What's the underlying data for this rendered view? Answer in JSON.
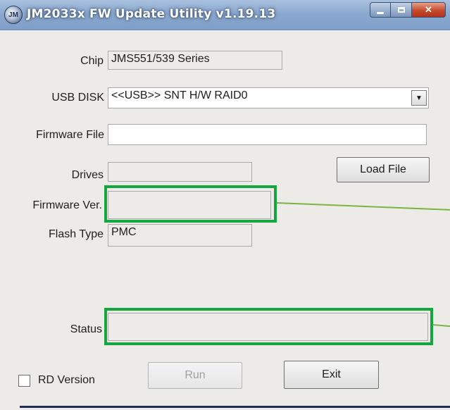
{
  "window": {
    "title": "JM2033x FW Update Utility v1.19.13",
    "icon_glyph": "JM"
  },
  "fields": {
    "chip": {
      "label": "Chip",
      "value": "JMS551/539 Series"
    },
    "usb_disk": {
      "label": "USB DISK",
      "value": "<<USB>> SNT H/W RAID0"
    },
    "firmware_file": {
      "label": "Firmware File",
      "value": ""
    },
    "drives": {
      "label": "Drives",
      "value": ""
    },
    "firmware_ver": {
      "label": "Firmware Ver.",
      "value": ""
    },
    "flash_type": {
      "label": "Flash Type",
      "value": "PMC"
    },
    "status": {
      "label": "Status",
      "value": ""
    }
  },
  "buttons": {
    "load_file": "Load File",
    "run": "Run",
    "exit": "Exit"
  },
  "checkbox": {
    "label": "RD Version",
    "checked": false
  },
  "colors": {
    "highlight": "#17a540",
    "leader_line": "#7cb342",
    "titlebar": "#8ba9cf"
  },
  "icons": {
    "minimize": "minimize-icon",
    "maximize": "maximize-icon",
    "close": "close-icon",
    "dropdown": "chevron-down-icon"
  }
}
